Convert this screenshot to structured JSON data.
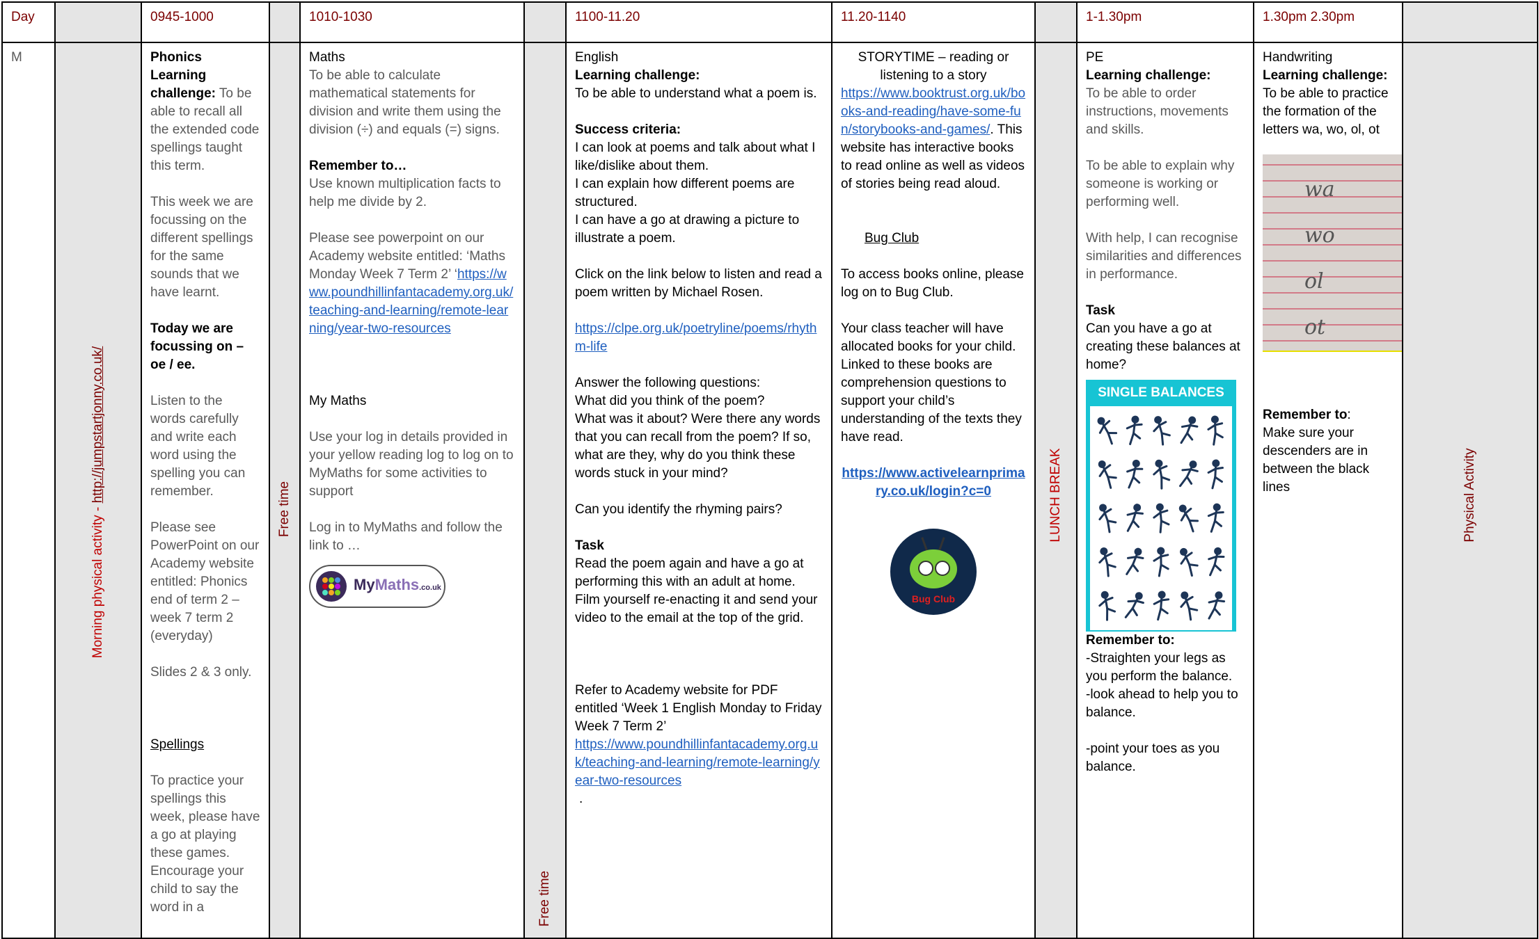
{
  "header": {
    "day": "Day",
    "slot1": "0945-1000",
    "slot2": "1010-1030",
    "slot3": "1100-11.20",
    "slot4": "11.20-1140",
    "slot5": "1-1.30pm",
    "slot6": "1.30pm 2.30pm"
  },
  "row": {
    "day_letter": "M",
    "morning_activity_label": "Morning physical activity - ",
    "morning_activity_link": "http://jumpstartjonny.co.uk/",
    "free_time_1": "Free time",
    "free_time_2": "Free time",
    "lunch": "LUNCH BREAK",
    "physical_activity": "Physical Activity"
  },
  "phonics": {
    "title": "Phonics",
    "lc_label": "Learning challenge:",
    "lc_text": " To be able to recall all the extended code spellings taught this term.",
    "focus_text": "This week we are focussing on the different spellings for the same sounds that we have learnt.",
    "today_label": "Today we are focussing on – oe / ee.",
    "listen_text": "Listen to the words carefully and write each word using the spelling you can remember.",
    "see_text": "Please see PowerPoint on our Academy website entitled: Phonics end of term 2 – week 7 term 2 (everyday)",
    "slides_text": "Slides 2 & 3 only.",
    "spellings_title": "Spellings",
    "spellings_text": "To practice your spellings this week, please have a go at playing these games. Encourage your child to say the word in a"
  },
  "maths": {
    "title": "Maths",
    "objective": "To be able to calculate mathematical statements for division and write them using the division (÷) and equals (=) signs.",
    "remember_title": "Remember to…",
    "remember_text": "Use known multiplication facts to help me divide by 2.",
    "see_prefix": "Please see powerpoint on our Academy website entitled: ‘Maths Monday Week 7 Term 2’ ‘",
    "see_link": "https://www.poundhillinfantacademy.org.uk/teaching-and-learning/remote-learning/year-two-resources",
    "mymaths_title": "My Maths",
    "mymaths_text": "Use your log in details provided in your yellow reading log to log on to MyMaths for some activities to support",
    "login_text": "Log in to MyMaths and follow the link to …",
    "logo_my": "My",
    "logo_maths": "Maths",
    "logo_suffix": ".co.uk"
  },
  "english": {
    "title": "English",
    "lc_label": "Learning challenge:",
    "lc_text": "To be able to understand what a poem is.",
    "sc_label": "Success criteria:",
    "sc1": "I can look at poems and talk about what I like/dislike about them.",
    "sc2": "I can explain how different poems are structured.",
    "sc3": "I can have a go at drawing a picture to illustrate a poem.",
    "click_text": "Click on the link below to listen and read a poem written by Michael Rosen.",
    "poem_link": "https://clpe.org.uk/poetryline/poems/rhythm-life",
    "answer_text": "Answer the following questions:",
    "q1": "What did you think of the poem?",
    "q2": "What was it about? Were there any words that you can recall from the poem? If so, what are they, why do you think these words stuck in your mind?",
    "rhyme_text": "Can you identify the rhyming pairs?",
    "task_title": "Task",
    "task_text": "Read the poem again and have a go at performing this with an adult at home. Film yourself re-enacting it and send your video to the email at the top of the grid.",
    "refer_text": "Refer to Academy website for PDF entitled ‘Week 1 English Monday to Friday Week 7 Term 2’",
    "refer_link": "https://www.poundhillinfantacademy.org.uk/teaching-and-learning/remote-learning/year-two-resources",
    "dot": "."
  },
  "story": {
    "title": "STORYTIME – reading or listening to a story",
    "link": "https://www.booktrust.org.uk/books-and-reading/have-some-fun/storybooks-and-games/",
    "link_after": ". This website has interactive books to read online as well as videos of stories being read aloud.",
    "bugclub_title": "Bug Club",
    "access_text": "To access books online, please log on to Bug Club.",
    "teacher_text": "Your class teacher will have allocated books for your child. Linked to these books are comprehension questions to support your child’s understanding of the texts they have read.",
    "active_link": "https://www.activelearnprimary.co.uk/login?c=0",
    "logo_text": "Bug Club"
  },
  "pe": {
    "title": "PE",
    "lc_label": "Learning challenge:",
    "lc1": "To be able to order instructions, movements and skills.",
    "lc2": "To be able to explain why someone is working or performing well.",
    "lc3": "With help, I can recognise similarities and differences in performance.",
    "task_title": "Task",
    "task_text": "Can you have a go at creating these balances at home?",
    "poster_title": "SINGLE BALANCES",
    "remember_title": "Remember to:",
    "r1": "-Straighten your legs as you perform the balance.",
    "r2": "-look ahead to help you to balance.",
    "r3": "-point your toes as you balance."
  },
  "handwriting": {
    "title": "Handwriting",
    "lc_label": "Learning challenge:",
    "lc_text": "To be able to practice the formation of the letters wa, wo, ol, ot",
    "photo_words": [
      "wa",
      "wo",
      "ol",
      "ot"
    ],
    "remember_title": "Remember to",
    "remember_colon": ":",
    "remember_text": "Make sure your descenders are in between the black lines"
  }
}
